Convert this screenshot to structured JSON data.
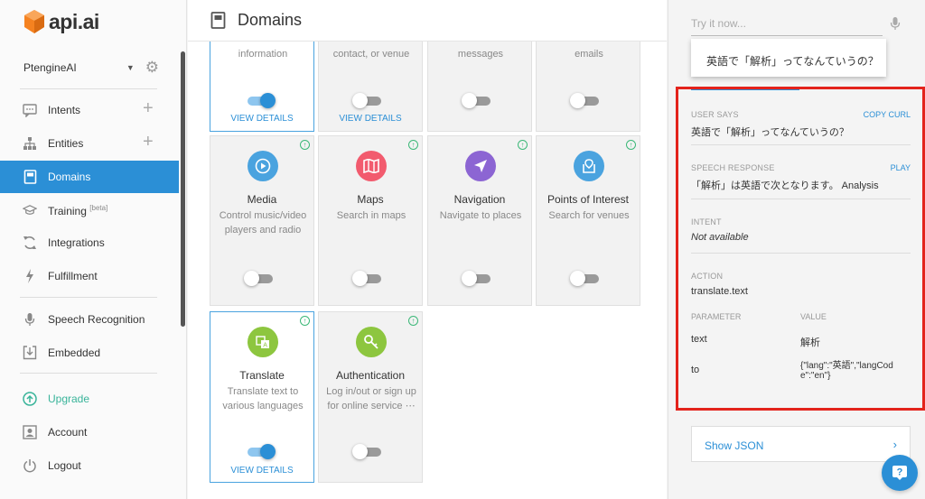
{
  "app": {
    "logo_text": "api.ai",
    "brand_color": "#f58220",
    "accent": "#2b8fd6",
    "highlight": "#e3231b"
  },
  "sidebar": {
    "agent": "PtengineAI",
    "items": [
      {
        "label": "Intents",
        "icon": "chat-bubble-icon"
      },
      {
        "label": "Entities",
        "icon": "hierarchy-icon"
      },
      {
        "label": "Domains",
        "icon": "book-icon"
      },
      {
        "label": "Training",
        "sup": "[beta]",
        "icon": "training-icon"
      },
      {
        "label": "Integrations",
        "icon": "refresh-icon"
      },
      {
        "label": "Fulfillment",
        "icon": "bolt-icon"
      },
      {
        "label": "Speech Recognition",
        "icon": "mic-icon"
      },
      {
        "label": "Embedded",
        "icon": "download-icon"
      },
      {
        "label": "Upgrade",
        "icon": "upgrade-icon"
      },
      {
        "label": "Account",
        "icon": "account-icon"
      },
      {
        "label": "Logout",
        "icon": "power-icon"
      }
    ]
  },
  "main": {
    "title": "Domains",
    "top_cards": [
      {
        "desc": "information",
        "enabled": true,
        "link": "VIEW DETAILS"
      },
      {
        "desc": "contact, or venue",
        "enabled": false,
        "link": "VIEW DETAILS"
      },
      {
        "desc": "messages",
        "enabled": false
      },
      {
        "desc": "emails",
        "enabled": false
      }
    ],
    "cards": [
      {
        "name": "Media",
        "desc": "Control music/video players and radio",
        "color": "#4aa3df",
        "icon": "play-icon",
        "enabled": false
      },
      {
        "name": "Maps",
        "desc": "Search in maps",
        "color": "#f25b6e",
        "icon": "map-icon",
        "enabled": false
      },
      {
        "name": "Navigation",
        "desc": "Navigate to places",
        "color": "#8c65d3",
        "icon": "navigation-arrow-icon",
        "enabled": false
      },
      {
        "name": "Points of Interest",
        "desc": "Search for venues",
        "color": "#4aa3df",
        "icon": "poi-icon",
        "enabled": false
      },
      {
        "name": "Translate",
        "desc": "Translate text to various languages",
        "color": "#8dc63f",
        "icon": "translate-icon",
        "enabled": true,
        "link": "VIEW DETAILS"
      },
      {
        "name": "Authentication",
        "desc": "Log in/out or sign up for online service ⋯",
        "color": "#8dc63f",
        "icon": "key-icon",
        "enabled": false
      }
    ]
  },
  "right": {
    "try_placeholder": "Try it now...",
    "query": "英語で「解析」ってなんていうの？",
    "user_says_label": "USER SAYS",
    "copy_curl": "COPY CURL",
    "user_says": "英語で「解析」ってなんていうの？",
    "speech_label": "SPEECH RESPONSE",
    "play": "PLAY",
    "speech": "「解析」は英語で次となります。 Analysis",
    "intent_label": "INTENT",
    "intent": "Not available",
    "action_label": "ACTION",
    "action": "translate.text",
    "param_label": "PARAMETER",
    "value_label": "VALUE",
    "params": [
      {
        "name": "text",
        "value": "解析"
      },
      {
        "name": "to",
        "value1": "{\"lang\":\"英語\",\"langCod",
        "value2": "e\":\"en\"}"
      }
    ],
    "show_json": "Show JSON"
  }
}
